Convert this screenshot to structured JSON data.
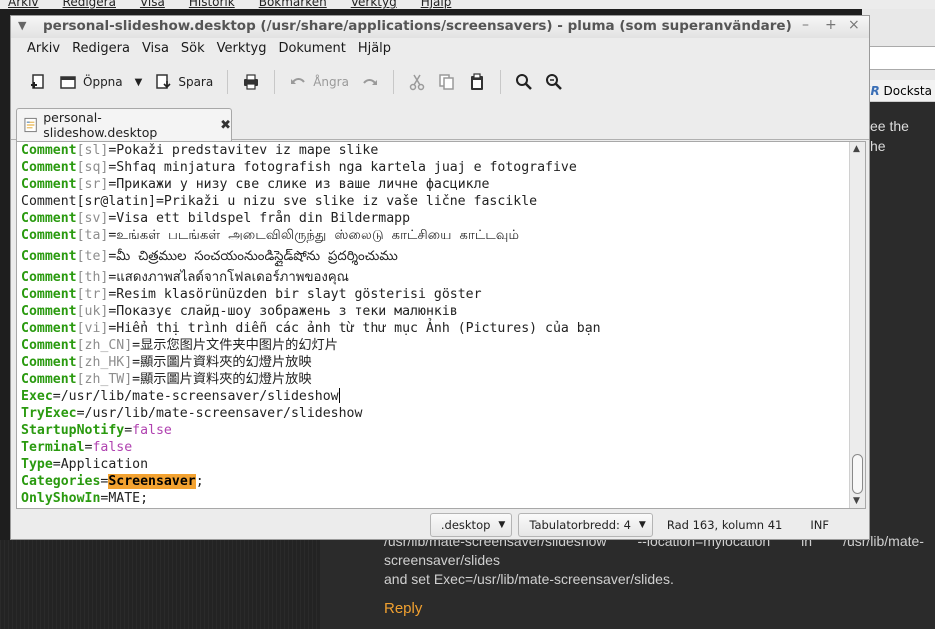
{
  "background": {
    "browser_menu": [
      "Arkiv",
      "Redigera",
      "Visa",
      "Historik",
      "Bokmärken",
      "Verktyg",
      "Hjälp"
    ],
    "bookmark_label": "Docksta",
    "side_text": [
      "ee the",
      "he"
    ],
    "comment_line1_left": "/usr/lib/mate-screensaver/slideshow",
    "comment_line1_mid": "--location=mylocation",
    "comment_line1_in": "in",
    "comment_line1_right": "/usr/lib/mate-",
    "comment_line2": "screensaver/slides",
    "comment_line3": "and set Exec=/usr/lib/mate-screensaver/slides.",
    "reply": "Reply"
  },
  "window": {
    "title": "personal-slideshow.desktop (/usr/share/applications/screensavers) - pluma (som superanvändare)",
    "controls": [
      "–",
      "+",
      "×"
    ]
  },
  "menubar": [
    "Arkiv",
    "Redigera",
    "Visa",
    "Sök",
    "Verktyg",
    "Dokument",
    "Hjälp"
  ],
  "toolbar": {
    "open_label": "Öppna",
    "save_label": "Spara",
    "undo_label": "Ångra"
  },
  "tab": {
    "label": "personal-slideshow.desktop"
  },
  "editor": {
    "lines": [
      {
        "key": "Comment",
        "locale": "[sl]",
        "value": "Pokaži predstavitev iz mape slike"
      },
      {
        "key": "Comment",
        "locale": "[sq]",
        "value": "Shfaq minjatura fotografish nga kartela juaj e fotografive"
      },
      {
        "key": "Comment",
        "locale": "[sr]",
        "value": "Прикажи у низу све слике из ваше личне фасцикле"
      },
      {
        "plain": "Comment[sr@latin]=Prikaži u nizu sve slike iz vaše lične fascikle"
      },
      {
        "key": "Comment",
        "locale": "[sv]",
        "value": "Visa ett bildspel från din Bildermapp"
      },
      {
        "key": "Comment",
        "locale": "[ta]",
        "value": "உங்கள் படங்கள் அடைவிலிருந்து ஸ்லைடு காட்சியை காட்டவும்"
      },
      {
        "key": "Comment",
        "locale": "[te]",
        "value": "మీ చిత్రముల సంచయంనుండిస్లైడ్‌షోను ప్రదర్శించుము",
        "tall": true
      },
      {
        "key": "Comment",
        "locale": "[th]",
        "value": "แสดงภาพสไลด์จากโฟลเดอร์ภาพของคุณ"
      },
      {
        "key": "Comment",
        "locale": "[tr]",
        "value": "Resim klasörünüzden bir slayt gösterisi göster"
      },
      {
        "key": "Comment",
        "locale": "[uk]",
        "value": "Показує слайд-шоу зображень з теки малюнків"
      },
      {
        "key": "Comment",
        "locale": "[vi]",
        "value": "Hiển thị trình diễn các ảnh từ thư mục Ảnh (Pictures) của bạn"
      },
      {
        "key": "Comment",
        "locale": "[zh_CN]",
        "value": "显示您图片文件夹中图片的幻灯片"
      },
      {
        "key": "Comment",
        "locale": "[zh_HK]",
        "value": "顯示圖片資料夾的幻燈片放映"
      },
      {
        "key": "Comment",
        "locale": "[zh_TW]",
        "value": "顯示圖片資料夾的幻燈片放映"
      },
      {
        "key": "Exec",
        "value": "/usr/lib/mate-screensaver/slideshow",
        "cursor": true
      },
      {
        "key": "TryExec",
        "value": "/usr/lib/mate-screensaver/slideshow"
      },
      {
        "key": "StartupNotify",
        "pvalue": "false"
      },
      {
        "key": "Terminal",
        "pvalue": "false"
      },
      {
        "key": "Type",
        "value": "Application"
      },
      {
        "key": "Categories",
        "hvalue": "Screensaver",
        "after": ";"
      },
      {
        "key": "OnlyShowIn",
        "value": "MATE;"
      }
    ]
  },
  "statusbar": {
    "language": ".desktop",
    "tab_width": "Tabulatorbredd:  4",
    "position": "Rad 163, kolumn 41",
    "mode": "INF"
  },
  "colors": {
    "key": "#2a9a0f",
    "bracket": "#8e8e8e",
    "boolean": "#b042b0",
    "search_highlight": "#f3a230"
  }
}
